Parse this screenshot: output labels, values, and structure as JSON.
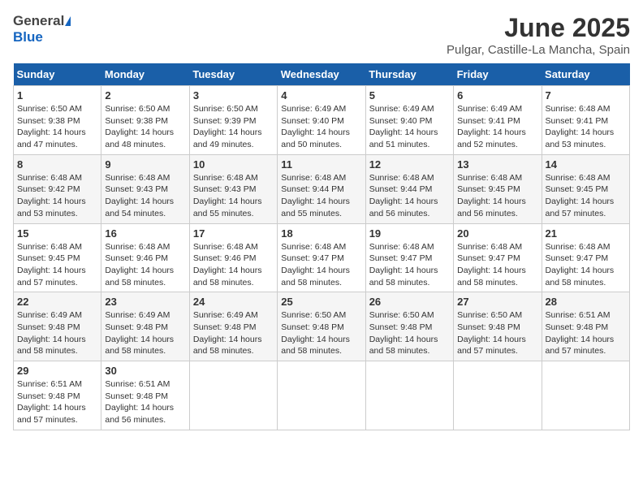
{
  "header": {
    "logo_general": "General",
    "logo_blue": "Blue",
    "month_title": "June 2025",
    "subtitle": "Pulgar, Castille-La Mancha, Spain"
  },
  "calendar": {
    "days_of_week": [
      "Sunday",
      "Monday",
      "Tuesday",
      "Wednesday",
      "Thursday",
      "Friday",
      "Saturday"
    ],
    "weeks": [
      [
        {
          "day": "1",
          "info": "Sunrise: 6:50 AM\nSunset: 9:38 PM\nDaylight: 14 hours\nand 47 minutes."
        },
        {
          "day": "2",
          "info": "Sunrise: 6:50 AM\nSunset: 9:38 PM\nDaylight: 14 hours\nand 48 minutes."
        },
        {
          "day": "3",
          "info": "Sunrise: 6:50 AM\nSunset: 9:39 PM\nDaylight: 14 hours\nand 49 minutes."
        },
        {
          "day": "4",
          "info": "Sunrise: 6:49 AM\nSunset: 9:40 PM\nDaylight: 14 hours\nand 50 minutes."
        },
        {
          "day": "5",
          "info": "Sunrise: 6:49 AM\nSunset: 9:40 PM\nDaylight: 14 hours\nand 51 minutes."
        },
        {
          "day": "6",
          "info": "Sunrise: 6:49 AM\nSunset: 9:41 PM\nDaylight: 14 hours\nand 52 minutes."
        },
        {
          "day": "7",
          "info": "Sunrise: 6:48 AM\nSunset: 9:41 PM\nDaylight: 14 hours\nand 53 minutes."
        }
      ],
      [
        {
          "day": "8",
          "info": "Sunrise: 6:48 AM\nSunset: 9:42 PM\nDaylight: 14 hours\nand 53 minutes."
        },
        {
          "day": "9",
          "info": "Sunrise: 6:48 AM\nSunset: 9:43 PM\nDaylight: 14 hours\nand 54 minutes."
        },
        {
          "day": "10",
          "info": "Sunrise: 6:48 AM\nSunset: 9:43 PM\nDaylight: 14 hours\nand 55 minutes."
        },
        {
          "day": "11",
          "info": "Sunrise: 6:48 AM\nSunset: 9:44 PM\nDaylight: 14 hours\nand 55 minutes."
        },
        {
          "day": "12",
          "info": "Sunrise: 6:48 AM\nSunset: 9:44 PM\nDaylight: 14 hours\nand 56 minutes."
        },
        {
          "day": "13",
          "info": "Sunrise: 6:48 AM\nSunset: 9:45 PM\nDaylight: 14 hours\nand 56 minutes."
        },
        {
          "day": "14",
          "info": "Sunrise: 6:48 AM\nSunset: 9:45 PM\nDaylight: 14 hours\nand 57 minutes."
        }
      ],
      [
        {
          "day": "15",
          "info": "Sunrise: 6:48 AM\nSunset: 9:45 PM\nDaylight: 14 hours\nand 57 minutes."
        },
        {
          "day": "16",
          "info": "Sunrise: 6:48 AM\nSunset: 9:46 PM\nDaylight: 14 hours\nand 58 minutes."
        },
        {
          "day": "17",
          "info": "Sunrise: 6:48 AM\nSunset: 9:46 PM\nDaylight: 14 hours\nand 58 minutes."
        },
        {
          "day": "18",
          "info": "Sunrise: 6:48 AM\nSunset: 9:47 PM\nDaylight: 14 hours\nand 58 minutes."
        },
        {
          "day": "19",
          "info": "Sunrise: 6:48 AM\nSunset: 9:47 PM\nDaylight: 14 hours\nand 58 minutes."
        },
        {
          "day": "20",
          "info": "Sunrise: 6:48 AM\nSunset: 9:47 PM\nDaylight: 14 hours\nand 58 minutes."
        },
        {
          "day": "21",
          "info": "Sunrise: 6:48 AM\nSunset: 9:47 PM\nDaylight: 14 hours\nand 58 minutes."
        }
      ],
      [
        {
          "day": "22",
          "info": "Sunrise: 6:49 AM\nSunset: 9:48 PM\nDaylight: 14 hours\nand 58 minutes."
        },
        {
          "day": "23",
          "info": "Sunrise: 6:49 AM\nSunset: 9:48 PM\nDaylight: 14 hours\nand 58 minutes."
        },
        {
          "day": "24",
          "info": "Sunrise: 6:49 AM\nSunset: 9:48 PM\nDaylight: 14 hours\nand 58 minutes."
        },
        {
          "day": "25",
          "info": "Sunrise: 6:50 AM\nSunset: 9:48 PM\nDaylight: 14 hours\nand 58 minutes."
        },
        {
          "day": "26",
          "info": "Sunrise: 6:50 AM\nSunset: 9:48 PM\nDaylight: 14 hours\nand 58 minutes."
        },
        {
          "day": "27",
          "info": "Sunrise: 6:50 AM\nSunset: 9:48 PM\nDaylight: 14 hours\nand 57 minutes."
        },
        {
          "day": "28",
          "info": "Sunrise: 6:51 AM\nSunset: 9:48 PM\nDaylight: 14 hours\nand 57 minutes."
        }
      ],
      [
        {
          "day": "29",
          "info": "Sunrise: 6:51 AM\nSunset: 9:48 PM\nDaylight: 14 hours\nand 57 minutes."
        },
        {
          "day": "30",
          "info": "Sunrise: 6:51 AM\nSunset: 9:48 PM\nDaylight: 14 hours\nand 56 minutes."
        },
        {
          "day": "",
          "info": ""
        },
        {
          "day": "",
          "info": ""
        },
        {
          "day": "",
          "info": ""
        },
        {
          "day": "",
          "info": ""
        },
        {
          "day": "",
          "info": ""
        }
      ]
    ]
  }
}
